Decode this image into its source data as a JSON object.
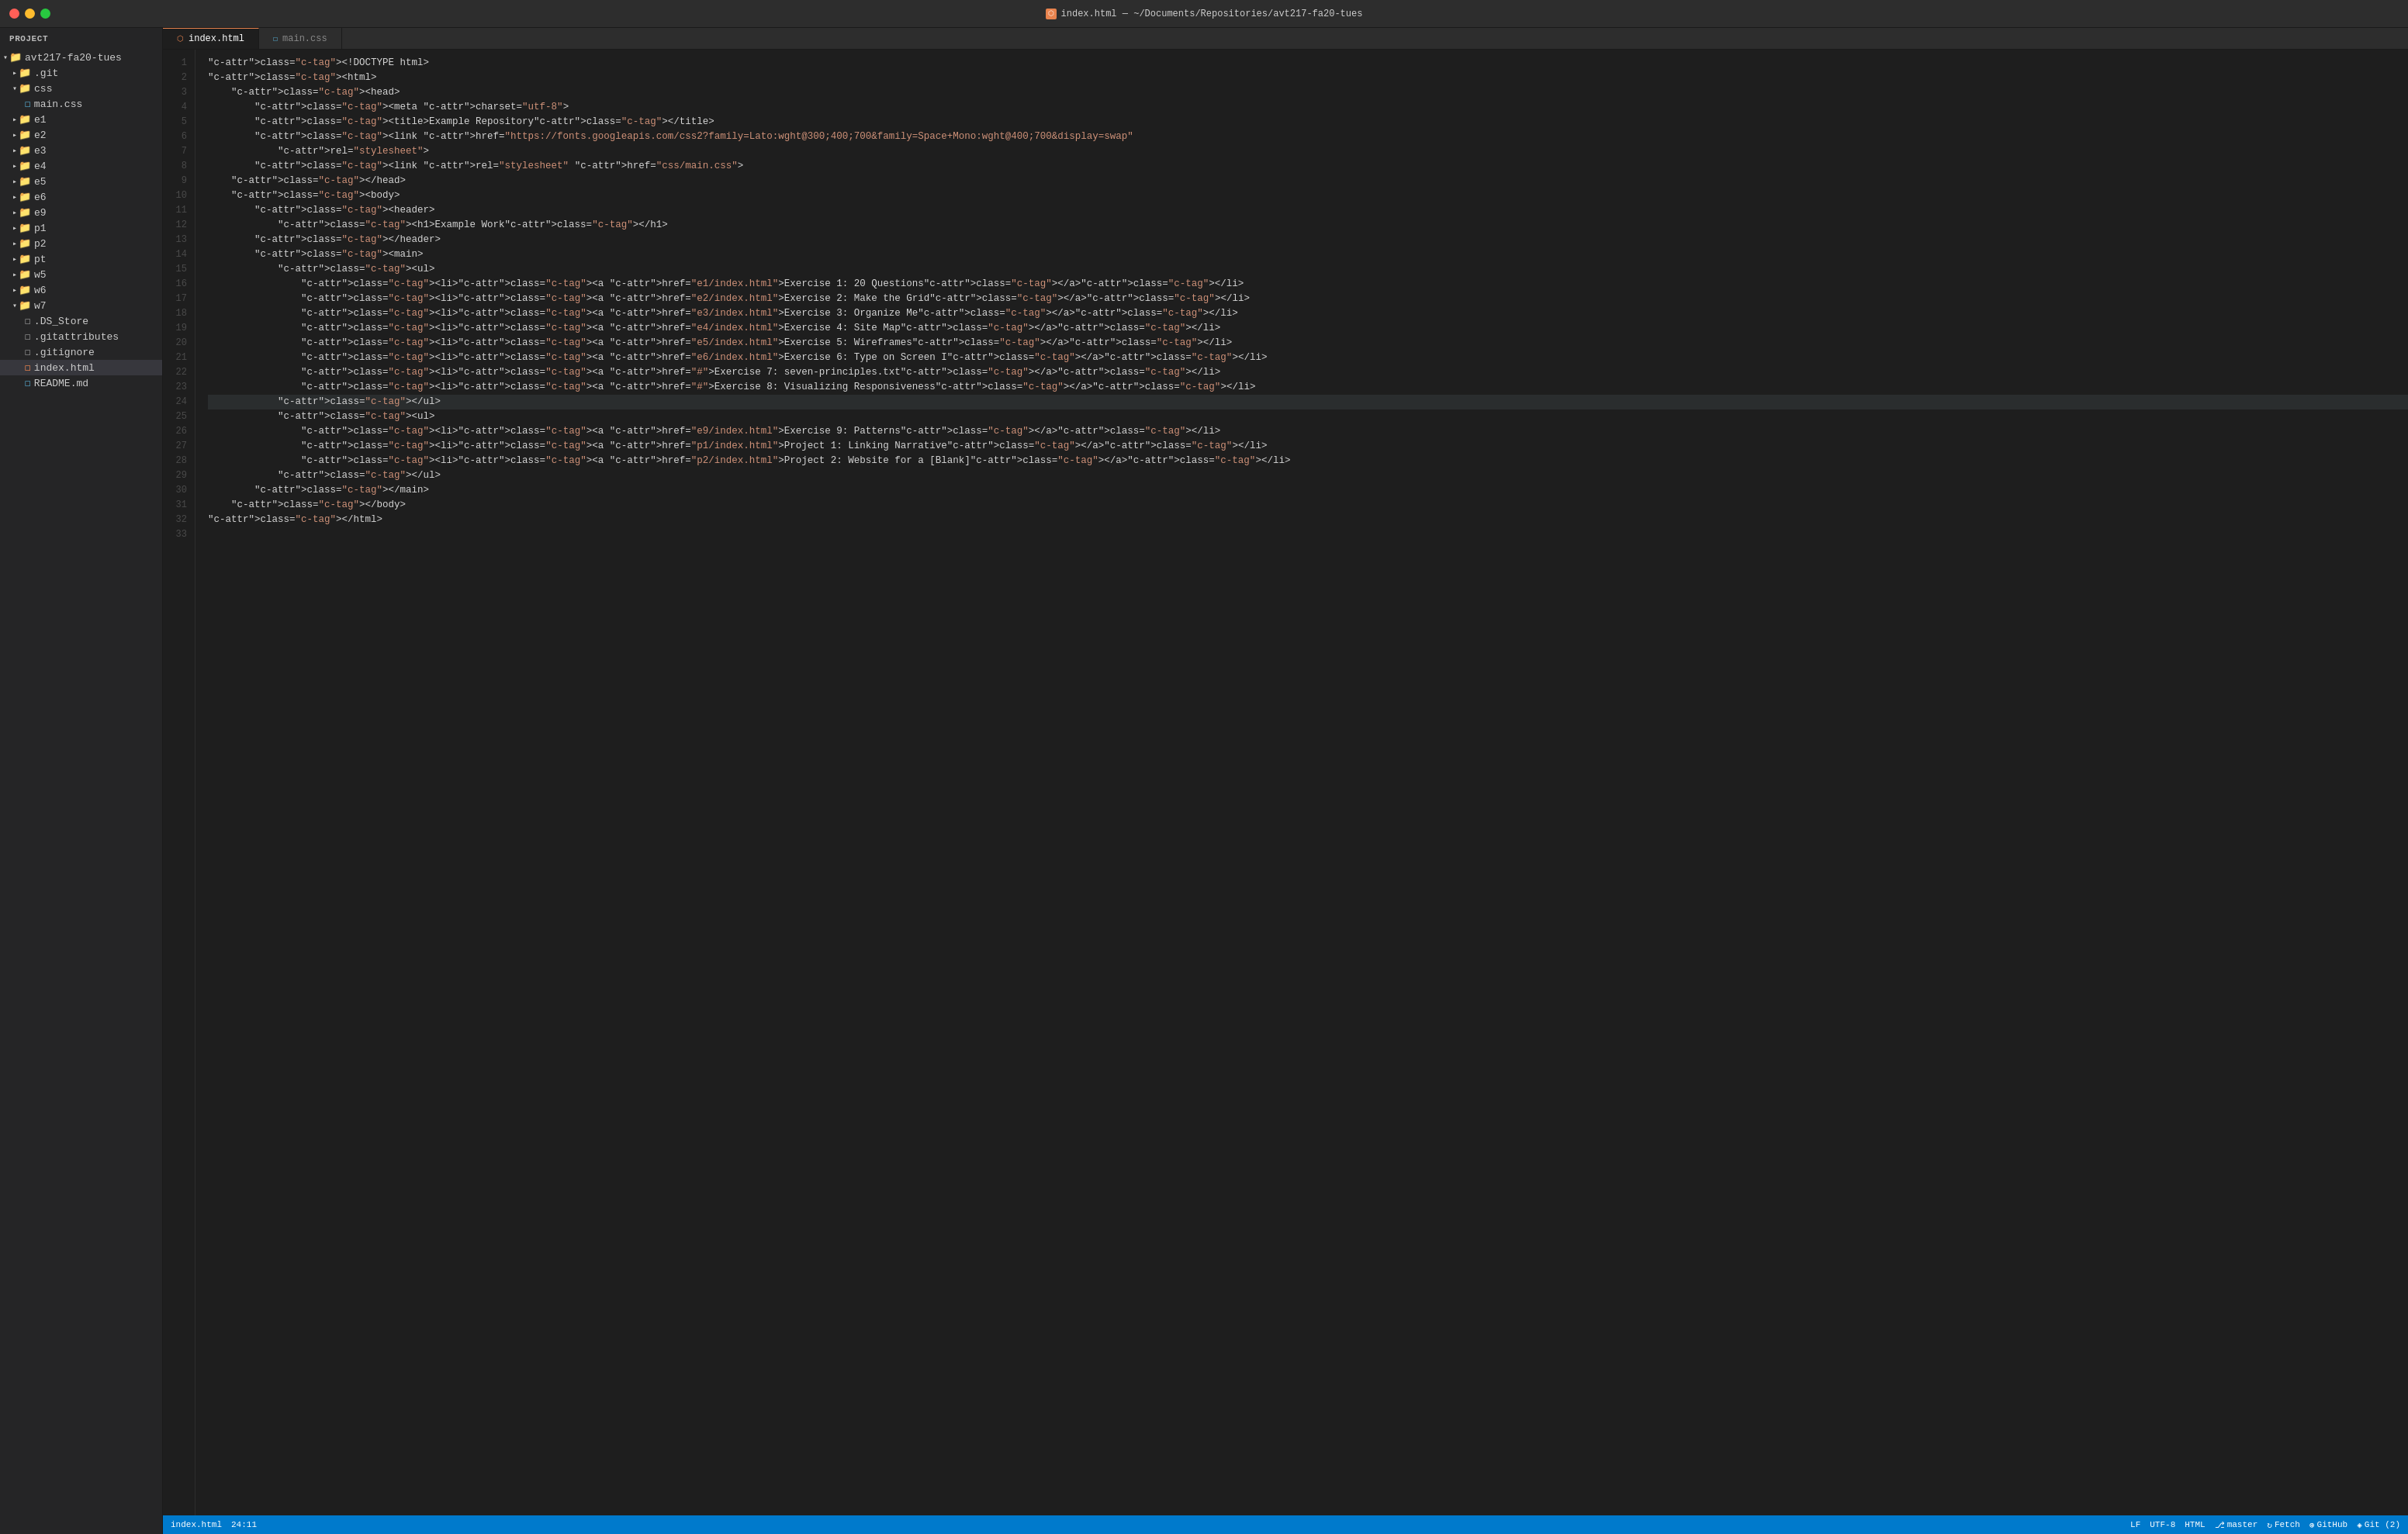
{
  "titlebar": {
    "title": "index.html — ~/Documents/Repositories/avt217-fa20-tues",
    "icon": "◻"
  },
  "tabs": [
    {
      "id": "index-html",
      "label": "index.html",
      "type": "html",
      "active": true
    },
    {
      "id": "main-css",
      "label": "main.css",
      "type": "css",
      "active": false
    }
  ],
  "sidebar": {
    "header": "Project",
    "root": {
      "name": "avt217-fa20-tues",
      "type": "folder",
      "expanded": true,
      "children": [
        {
          "name": ".git",
          "type": "folder",
          "expanded": false,
          "indent": 1
        },
        {
          "name": "css",
          "type": "folder",
          "expanded": true,
          "indent": 1,
          "children": [
            {
              "name": "main.css",
              "type": "css",
              "indent": 2
            }
          ]
        },
        {
          "name": "e1",
          "type": "folder",
          "expanded": false,
          "indent": 1
        },
        {
          "name": "e2",
          "type": "folder",
          "expanded": false,
          "indent": 1
        },
        {
          "name": "e3",
          "type": "folder",
          "expanded": false,
          "indent": 1
        },
        {
          "name": "e4",
          "type": "folder",
          "expanded": false,
          "indent": 1
        },
        {
          "name": "e5",
          "type": "folder",
          "expanded": false,
          "indent": 1
        },
        {
          "name": "e6",
          "type": "folder",
          "expanded": false,
          "indent": 1
        },
        {
          "name": "e9",
          "type": "folder",
          "expanded": false,
          "indent": 1
        },
        {
          "name": "p1",
          "type": "folder",
          "expanded": false,
          "indent": 1
        },
        {
          "name": "p2",
          "type": "folder",
          "expanded": false,
          "indent": 1
        },
        {
          "name": "pt",
          "type": "folder",
          "expanded": false,
          "indent": 1
        },
        {
          "name": "w5",
          "type": "folder",
          "expanded": false,
          "indent": 1
        },
        {
          "name": "w6",
          "type": "folder",
          "expanded": false,
          "indent": 1
        },
        {
          "name": "w7",
          "type": "folder",
          "expanded": true,
          "indent": 1,
          "children": [
            {
              "name": ".DS_Store",
              "type": "ds",
              "indent": 2
            },
            {
              "name": ".gitattributes",
              "type": "gitignore",
              "indent": 2
            },
            {
              "name": ".gitignore",
              "type": "gitignore",
              "indent": 2
            },
            {
              "name": "index.html",
              "type": "html",
              "indent": 2,
              "active": true
            },
            {
              "name": "README.md",
              "type": "md",
              "indent": 2
            }
          ]
        }
      ]
    }
  },
  "code": {
    "filename": "index.html",
    "cursor_line": 24,
    "cursor_col": 11,
    "lines": [
      {
        "num": 1,
        "content": "<!DOCTYPE html>"
      },
      {
        "num": 2,
        "content": "<html>"
      },
      {
        "num": 3,
        "content": "    <head>"
      },
      {
        "num": 4,
        "content": "        <meta charset=\"utf-8\">"
      },
      {
        "num": 5,
        "content": "        <title>Example Repository</title>"
      },
      {
        "num": 6,
        "content": "        <link href=\"https://fonts.googleapis.com/css2?family=Lato:wght@300;400;700&family=Space+Mono:wght@400;700&display=swap\""
      },
      {
        "num": 7,
        "content": "            rel=\"stylesheet\">"
      },
      {
        "num": 8,
        "content": "        <link rel=\"stylesheet\" href=\"css/main.css\">"
      },
      {
        "num": 9,
        "content": "    </head>"
      },
      {
        "num": 10,
        "content": "    <body>"
      },
      {
        "num": 11,
        "content": "        <header>"
      },
      {
        "num": 12,
        "content": "            <h1>Example Work</h1>"
      },
      {
        "num": 13,
        "content": "        </header>"
      },
      {
        "num": 14,
        "content": "        <main>"
      },
      {
        "num": 15,
        "content": "            <ul>"
      },
      {
        "num": 16,
        "content": "                <li><a href=\"e1/index.html\">Exercise 1: 20 Questions</a></li>"
      },
      {
        "num": 17,
        "content": "                <li><a href=\"e2/index.html\">Exercise 2: Make the Grid</a></li>"
      },
      {
        "num": 18,
        "content": "                <li><a href=\"e3/index.html\">Exercise 3: Organize Me</a></li>"
      },
      {
        "num": 19,
        "content": "                <li><a href=\"e4/index.html\">Exercise 4: Site Map</a></li>"
      },
      {
        "num": 20,
        "content": "                <li><a href=\"e5/index.html\">Exercise 5: Wireframes</a></li>"
      },
      {
        "num": 21,
        "content": "                <li><a href=\"e6/index.html\">Exercise 6: Type on Screen I</a></li>"
      },
      {
        "num": 22,
        "content": "                <li><a href=\"#\">Exercise 7: seven-principles.txt</a></li>"
      },
      {
        "num": 23,
        "content": "                <li><a href=\"#\">Exercise 8: Visualizing Responsiveness</a></li>"
      },
      {
        "num": 24,
        "content": "            </ul>"
      },
      {
        "num": 25,
        "content": "            <ul>"
      },
      {
        "num": 26,
        "content": "                <li><a href=\"e9/index.html\">Exercise 9: Patterns</a></li>"
      },
      {
        "num": 27,
        "content": "                <li><a href=\"p1/index.html\">Project 1: Linking Narrative</a></li>"
      },
      {
        "num": 28,
        "content": "                <li><a href=\"p2/index.html\">Project 2: Website for a [Blank]</a></li>"
      },
      {
        "num": 29,
        "content": "            </ul>"
      },
      {
        "num": 30,
        "content": "        </main>"
      },
      {
        "num": 31,
        "content": "    </body>"
      },
      {
        "num": 32,
        "content": "</html>"
      },
      {
        "num": 33,
        "content": ""
      }
    ]
  },
  "statusbar": {
    "file": "index.html",
    "position": "24:11",
    "encoding": "LF",
    "charset": "UTF-8",
    "language": "HTML",
    "branch": "master",
    "fetch": "Fetch",
    "github": "GitHub",
    "git_changes": "Git (2)"
  }
}
